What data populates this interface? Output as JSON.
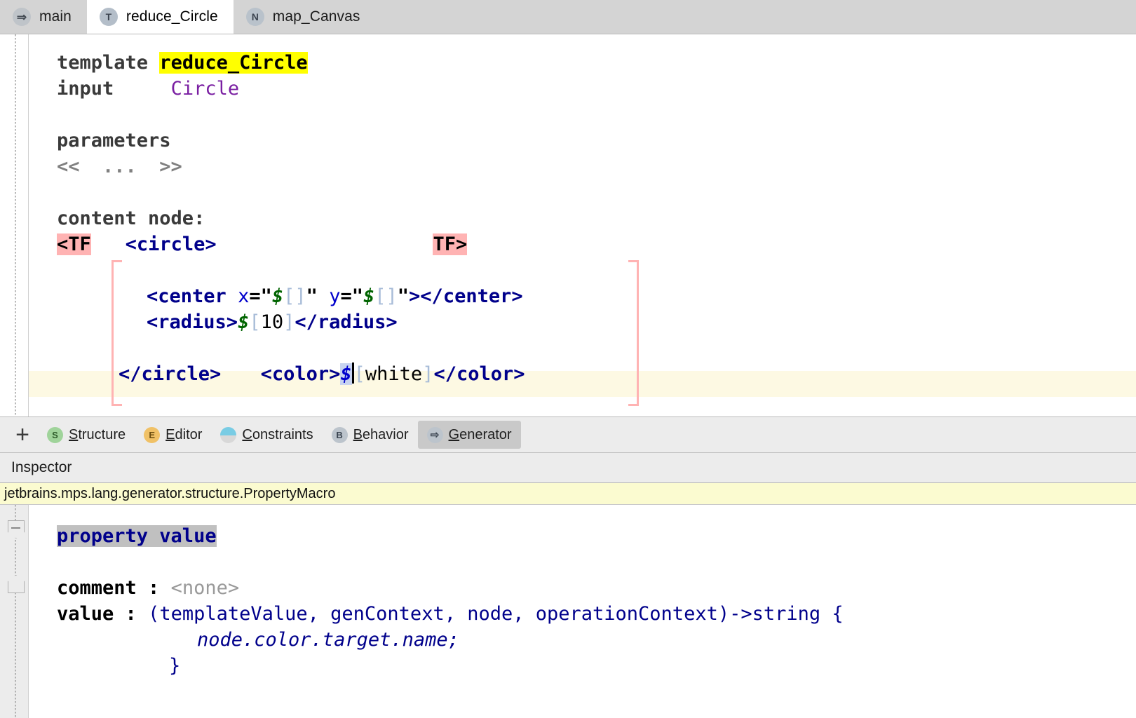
{
  "window": {
    "title": "reduce_Circle"
  },
  "tabs": [
    {
      "id": "main",
      "label": "main",
      "icon": "arrow-right-icon",
      "icon_letter": "⇒",
      "active": false
    },
    {
      "id": "reduce_circle",
      "label": "reduce_Circle",
      "icon": "template-icon",
      "icon_letter": "T",
      "active": true
    },
    {
      "id": "map_canvas",
      "label": "map_Canvas",
      "icon": "node-icon",
      "icon_letter": "N",
      "active": false
    }
  ],
  "editor": {
    "template_keyword": "template",
    "template_name": "reduce_Circle",
    "input_keyword": "input",
    "input_value": "Circle",
    "parameters_keyword": "parameters",
    "parameters_placeholder": "<<  ...  >>",
    "content_node_label": "content node:",
    "tf_open": "<TF",
    "tf_close": "TF>",
    "line_circle_open": "<circle>",
    "line_center": {
      "tag_open": "<center",
      "attr_x": "x",
      "attr_y": "y",
      "eq": "=",
      "quote": "\"",
      "macro": "$",
      "macro_open": "[",
      "macro_close": "]",
      "close_center": "></center>"
    },
    "line_radius": {
      "open": "<radius>",
      "macro": "$",
      "br_open": "[",
      "value": "10",
      "br_close": "]",
      "close": "</radius>"
    },
    "line_color": {
      "open": "<color>",
      "macro": "$",
      "br_open": "[",
      "value": "white",
      "br_close": "]",
      "close": "</color>"
    },
    "line_circle_close": "</circle>",
    "bulb_icon": "lightbulb-icon",
    "colors": {
      "highlight_name": "#ffff00",
      "tf_marker": "#ffb3b3",
      "caret_row": "#fdf9e3",
      "tag": "#00008b",
      "concept": "#7a1fa2",
      "macro": "#006400",
      "selection": "#c8d4f0"
    }
  },
  "aspect_bar": {
    "add_label": "+",
    "tabs": [
      {
        "id": "structure",
        "label": "Structure",
        "mnemonic": "S",
        "icon": "structure-icon",
        "icon_letter": "S",
        "color": "#9fd39a",
        "selected": false
      },
      {
        "id": "editor",
        "label": "Editor",
        "mnemonic": "E",
        "icon": "editor-icon",
        "icon_letter": "E",
        "color": "#f0c166",
        "selected": false
      },
      {
        "id": "constraints",
        "label": "Constraints",
        "mnemonic": "C",
        "icon": "constraints-icon",
        "icon_letter": "",
        "color": "#79cce4",
        "selected": false
      },
      {
        "id": "behavior",
        "label": "Behavior",
        "mnemonic": "B",
        "icon": "behavior-icon",
        "icon_letter": "B",
        "color": "#bcc4cc",
        "selected": false
      },
      {
        "id": "generator",
        "label": "Generator",
        "mnemonic": "G",
        "icon": "generator-icon",
        "icon_letter": "⇨",
        "color": "#bcc4cc",
        "selected": true
      }
    ]
  },
  "inspector": {
    "title": "Inspector",
    "concept_fqn": "jetbrains.mps.lang.generator.structure.PropertyMacro",
    "property_value_label": "property value",
    "comment_label": "comment :",
    "comment_value": "<none>",
    "value_label": "value :",
    "value_signature": "(templateValue, genContext, node, operationContext)->string {",
    "value_body": "node.color.target.name;",
    "value_close": "}"
  }
}
